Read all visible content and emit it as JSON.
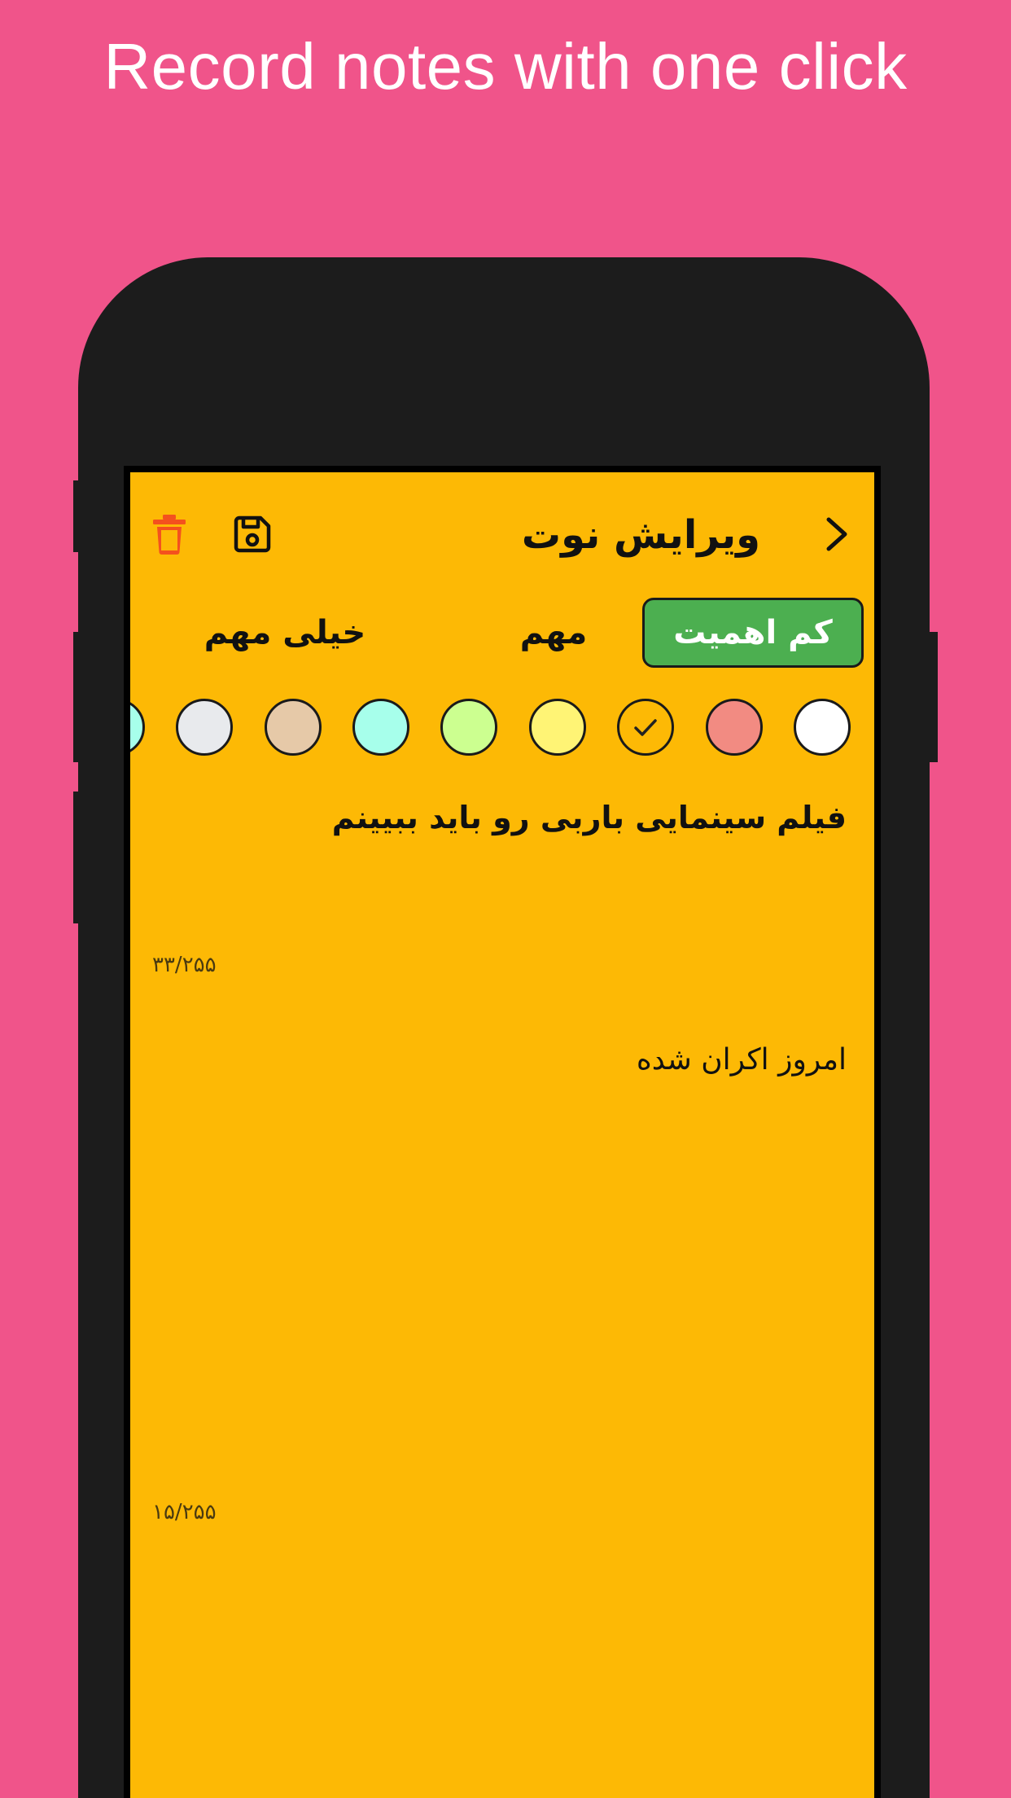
{
  "promo": {
    "title": "Record notes with one click"
  },
  "colors": {
    "background": "#F0548A",
    "phone_body": "#1C1C1C",
    "screen": "#FDB905",
    "accent_green": "#4CAF50",
    "delete_red": "#F4511E"
  },
  "header": {
    "title": "ویرایش نوت",
    "back_icon": "chevron-right-icon",
    "save_icon": "floppy-disk-icon",
    "delete_icon": "trash-icon"
  },
  "priority": {
    "options": [
      {
        "label": "کم اهمیت",
        "selected": true
      },
      {
        "label": "مهم",
        "selected": false
      },
      {
        "label": "خیلی مهم",
        "selected": false
      }
    ]
  },
  "swatches": [
    {
      "name": "white",
      "color": "#FFFFFF",
      "selected": false
    },
    {
      "name": "salmon",
      "color": "#F28B82",
      "selected": false
    },
    {
      "name": "amber",
      "color": "#FDB905",
      "selected": true
    },
    {
      "name": "yellow",
      "color": "#FFF475",
      "selected": false
    },
    {
      "name": "light-green",
      "color": "#CCFF90",
      "selected": false
    },
    {
      "name": "aqua",
      "color": "#A7FFEB",
      "selected": false
    },
    {
      "name": "beige",
      "color": "#E6C9A8",
      "selected": false
    },
    {
      "name": "light-gray",
      "color": "#E8EAED",
      "selected": false
    },
    {
      "name": "aqua-2",
      "color": "#A7FFEB",
      "selected": false
    }
  ],
  "note": {
    "title": "فیلم سینمایی باربی رو باید ببیینم",
    "title_counter": "۳۳/۲۵۵",
    "body": "امروز اکران شده",
    "body_counter": "۱۵/۲۵۵"
  }
}
